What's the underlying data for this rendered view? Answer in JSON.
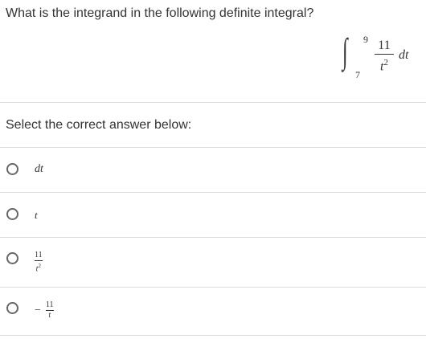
{
  "question": {
    "text": "What is the integrand in the following definite integral?",
    "integral": {
      "upper": "9",
      "lower": "7",
      "numerator": "11",
      "denominator_base": "t",
      "denominator_exp": "2",
      "differential": "dt"
    }
  },
  "prompt": "Select the correct answer below:",
  "options": [
    {
      "text": "dt"
    },
    {
      "text": "t"
    },
    {
      "numerator": "11",
      "denominator_base": "t",
      "denominator_exp": "2"
    },
    {
      "sign": "−",
      "numerator": "11",
      "denominator_base": "t"
    }
  ],
  "colors": {
    "text": "#333333",
    "divider": "#dddddd",
    "radio_border": "#666666"
  }
}
